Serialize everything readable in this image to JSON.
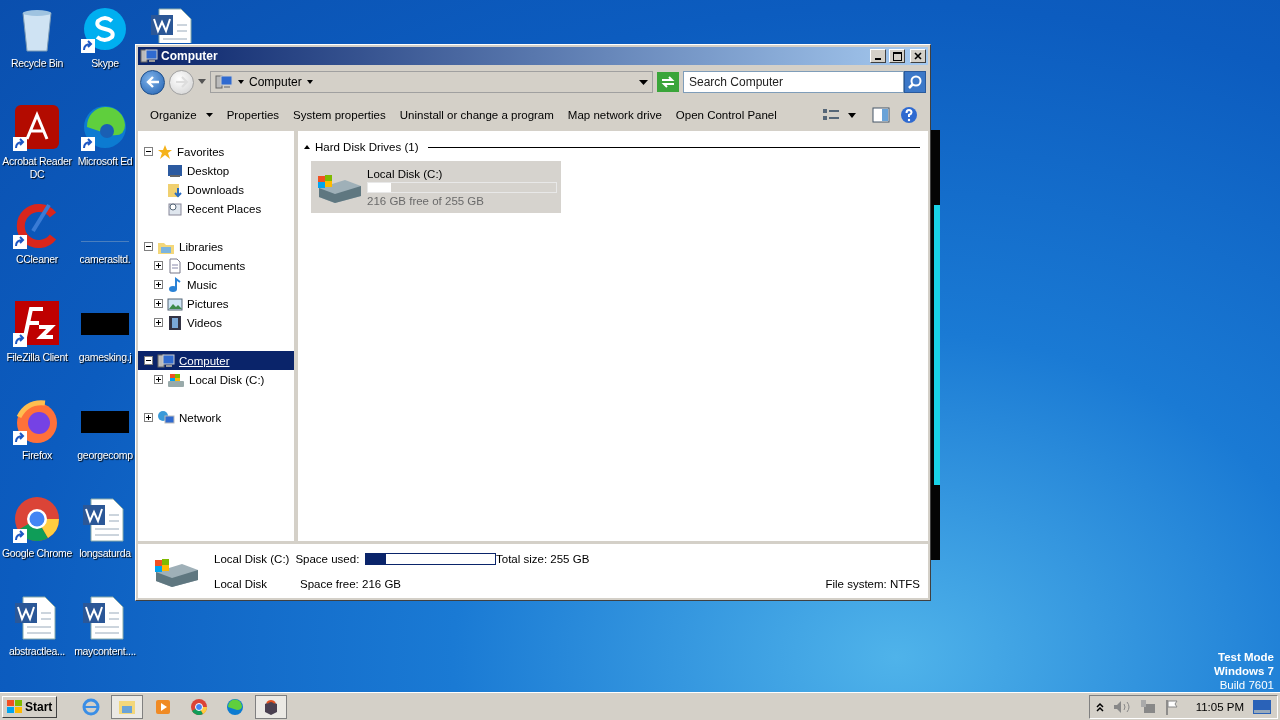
{
  "desktop_icons": [
    {
      "label": "Recycle Bin",
      "kind": "recycle",
      "shortcut": false
    },
    {
      "label": "Acrobat Reader DC",
      "kind": "acrobat",
      "shortcut": true
    },
    {
      "label": "CCleaner",
      "kind": "ccleaner",
      "shortcut": true
    },
    {
      "label": "FileZilla Client",
      "kind": "filezilla",
      "shortcut": true
    },
    {
      "label": "Firefox",
      "kind": "firefox",
      "shortcut": true
    },
    {
      "label": "Google Chrome",
      "kind": "chrome",
      "shortcut": true
    },
    {
      "label": "abstractlea...",
      "kind": "word",
      "shortcut": false
    },
    {
      "label": "Skype",
      "kind": "skype",
      "shortcut": true
    },
    {
      "label": "Microsoft Ed",
      "kind": "edge",
      "shortcut": true
    },
    {
      "label": "camerasltd.",
      "kind": "blank",
      "shortcut": false
    },
    {
      "label": "gamesking.j",
      "kind": "black",
      "shortcut": false
    },
    {
      "label": "georgecomp",
      "kind": "black",
      "shortcut": false
    },
    {
      "label": "longsaturda",
      "kind": "word",
      "shortcut": false
    },
    {
      "label": "maycontent....",
      "kind": "word",
      "shortcut": false
    },
    {
      "kind": "word",
      "shortcut": false
    }
  ],
  "window": {
    "title": "Computer",
    "address": {
      "crumb": "Computer"
    },
    "search": {
      "placeholder": "Search Computer"
    },
    "toolbar": [
      {
        "label": "Organize",
        "menu": true
      },
      {
        "label": "Properties",
        "menu": false
      },
      {
        "label": "System properties",
        "menu": false
      },
      {
        "label": "Uninstall or change a program",
        "menu": false
      },
      {
        "label": "Map network drive",
        "menu": false
      },
      {
        "label": "Open Control Panel",
        "menu": false
      }
    ],
    "nav_tree": [
      {
        "label": "Favorites",
        "kind": "star",
        "expanded": true,
        "selected": false,
        "children": [
          {
            "label": "Desktop",
            "kind": "desktop",
            "selected": false
          },
          {
            "label": "Downloads",
            "kind": "downloads",
            "selected": false
          },
          {
            "label": "Recent Places",
            "kind": "recent",
            "selected": false
          }
        ]
      },
      {
        "label": "Libraries",
        "kind": "library",
        "expanded": true,
        "selected": false,
        "children": [
          {
            "label": "Documents",
            "kind": "documents",
            "expanded": false,
            "selected": false
          },
          {
            "label": "Music",
            "kind": "music",
            "expanded": false,
            "selected": false
          },
          {
            "label": "Pictures",
            "kind": "pictures",
            "expanded": false,
            "selected": false
          },
          {
            "label": "Videos",
            "kind": "videos",
            "expanded": false,
            "selected": false
          }
        ]
      },
      {
        "label": "Computer",
        "kind": "computer",
        "expanded": true,
        "selected": true,
        "children": [
          {
            "label": "Local Disk (C:)",
            "kind": "disk",
            "expanded": false,
            "selected": false
          }
        ]
      },
      {
        "label": "Network",
        "kind": "network",
        "expanded": false,
        "selected": false
      }
    ],
    "group": {
      "title": "Hard Disk Drives (1)",
      "expanded": true
    },
    "drives": [
      {
        "name": "Local Disk (C:)",
        "level": 0.12,
        "free_text": "216 GB free of 255 GB",
        "selected": true
      }
    ],
    "details": {
      "name": "Local Disk (C:)",
      "type": "Local Disk",
      "used_label": "Space used:",
      "level": 0.15,
      "free": "Space free: 216 GB",
      "total": "Total size: 255 GB",
      "file_system": "File system: NTFS"
    }
  },
  "os_notice": [
    "Test Mode",
    "Windows 7",
    "Build 7601"
  ],
  "taskbar": {
    "start": "Start",
    "apps": [
      {
        "kind": "ie",
        "active": false
      },
      {
        "kind": "explorer",
        "active": true
      },
      {
        "kind": "media",
        "active": false
      },
      {
        "kind": "chrome",
        "active": false
      },
      {
        "kind": "edge",
        "active": false
      },
      {
        "kind": "package",
        "active": true
      }
    ],
    "clock": "11:05 PM"
  }
}
